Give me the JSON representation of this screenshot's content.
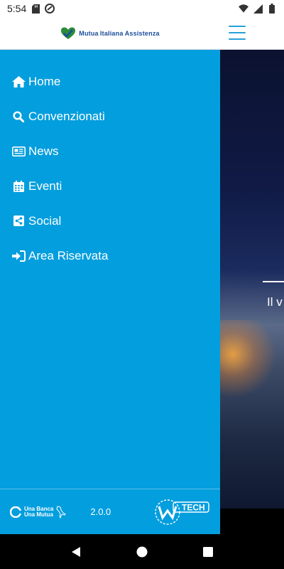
{
  "status": {
    "time": "5:54",
    "icons": [
      "sd-card-icon",
      "sync-icon",
      "wifi-icon",
      "signal-icon",
      "battery-icon"
    ]
  },
  "header": {
    "logo_lines": [
      "Mutua",
      "Italiana",
      "Assistenza"
    ],
    "menu_icon": "hamburger-icon"
  },
  "background": {
    "caption": "Il v"
  },
  "menu": {
    "items": [
      {
        "label": "Home",
        "icon": "home-icon"
      },
      {
        "label": "Convenzionati",
        "icon": "search-icon"
      },
      {
        "label": "News",
        "icon": "newspaper-icon"
      },
      {
        "label": "Eventi",
        "icon": "calendar-icon"
      },
      {
        "label": "Social",
        "icon": "share-icon"
      },
      {
        "label": "Area Riservata",
        "icon": "sign-in-icon"
      }
    ]
  },
  "footer": {
    "logo_line1": "Una Banca",
    "logo_line2": "Una Mutua",
    "version": "2.0.0",
    "wtech_label": "TECH"
  },
  "colors": {
    "drawer": "#039ede",
    "accent": "#2aa0d8"
  }
}
